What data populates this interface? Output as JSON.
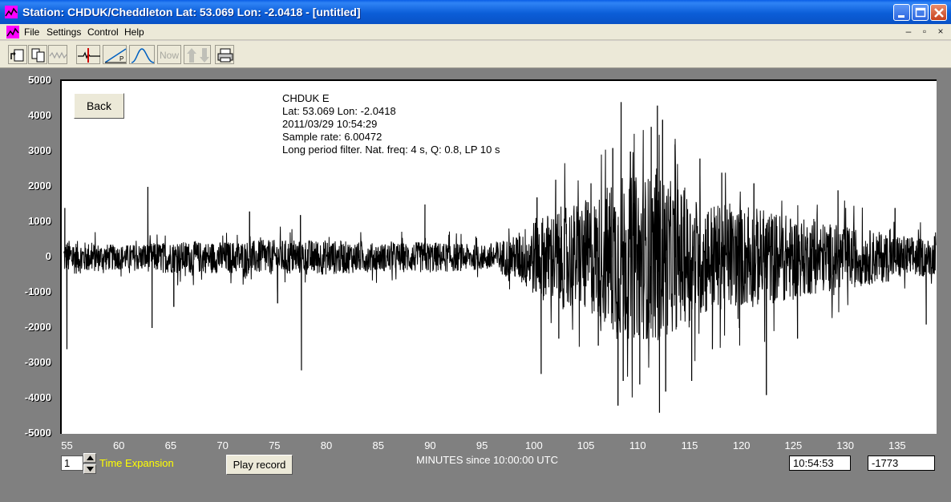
{
  "window": {
    "title": "Station: CHDUK/Cheddleton Lat: 53.069 Lon: -2.0418 - [untitled]"
  },
  "menu": [
    "File",
    "Settings",
    "Control",
    "Help"
  ],
  "toolbar": {
    "now_label": "Now"
  },
  "plot": {
    "back_label": "Back",
    "info": {
      "station": "CHDUK  E",
      "location": "Lat: 53.069 Lon: -2.0418",
      "datetime": "2011/03/29 10:54:29",
      "sample_rate": "Sample rate: 6.00472",
      "filter": "Long period filter. Nat. freq: 4 s, Q: 0.8, LP 10 s"
    }
  },
  "controls": {
    "time_expansion_value": "1",
    "time_expansion_label": "Time Expansion",
    "play_label": "Play record",
    "time_readout": "10:54:53",
    "value_readout": "-1773"
  },
  "chart_data": {
    "type": "line",
    "xlabel": "MINUTES since 10:00:00 UTC",
    "ylabel": "",
    "xlim": [
      54.5,
      138.8
    ],
    "ylim": [
      -5000,
      5000
    ],
    "xticks": [
      55,
      60,
      65,
      70,
      75,
      80,
      85,
      90,
      95,
      100,
      105,
      110,
      115,
      120,
      125,
      130,
      135
    ],
    "yticks": [
      5000,
      4000,
      3000,
      2000,
      1000,
      0,
      -1000,
      -2000,
      -3000,
      -4000,
      -5000
    ],
    "spikes": [
      {
        "x": 54.8,
        "v": 1400
      },
      {
        "x": 55.0,
        "v": -2600
      },
      {
        "x": 62.8,
        "v": 2000
      },
      {
        "x": 63.2,
        "v": -2000
      },
      {
        "x": 65.3,
        "v": -1400
      },
      {
        "x": 72.6,
        "v": 1300
      },
      {
        "x": 75.3,
        "v": -1300
      },
      {
        "x": 77.5,
        "v": 1200
      },
      {
        "x": 77.6,
        "v": -3200
      },
      {
        "x": 89.5,
        "v": 1500
      },
      {
        "x": 100.3,
        "v": 1700
      },
      {
        "x": 100.7,
        "v": -3300
      },
      {
        "x": 102.1,
        "v": 2200
      },
      {
        "x": 102.4,
        "v": -2300
      },
      {
        "x": 105.5,
        "v": 2100
      },
      {
        "x": 106.2,
        "v": -2500
      },
      {
        "x": 107.6,
        "v": 3100
      },
      {
        "x": 108.1,
        "v": -4200
      },
      {
        "x": 108.4,
        "v": 4400
      },
      {
        "x": 108.6,
        "v": -3500
      },
      {
        "x": 109.3,
        "v": 3000
      },
      {
        "x": 110.2,
        "v": -3600
      },
      {
        "x": 111.3,
        "v": 3700
      },
      {
        "x": 111.9,
        "v": 4300
      },
      {
        "x": 112.1,
        "v": -4400
      },
      {
        "x": 112.4,
        "v": 3900
      },
      {
        "x": 112.7,
        "v": -3800
      },
      {
        "x": 113.6,
        "v": 3200
      },
      {
        "x": 115.2,
        "v": -3500
      },
      {
        "x": 116.0,
        "v": 2800
      },
      {
        "x": 117.2,
        "v": -2600
      },
      {
        "x": 118.1,
        "v": 2400
      },
      {
        "x": 119.8,
        "v": -2000
      },
      {
        "x": 121.2,
        "v": 2100
      },
      {
        "x": 122.4,
        "v": -3900
      },
      {
        "x": 125.4,
        "v": -2300
      },
      {
        "x": 129.3,
        "v": 1900
      },
      {
        "x": 134.8,
        "v": 1400
      },
      {
        "x": 137.8,
        "v": -1900
      },
      {
        "x": 138.6,
        "v": 600
      }
    ],
    "envelope": [
      {
        "x": 55,
        "amp": 500
      },
      {
        "x": 60,
        "amp": 350
      },
      {
        "x": 65,
        "amp": 450
      },
      {
        "x": 70,
        "amp": 450
      },
      {
        "x": 75,
        "amp": 500
      },
      {
        "x": 80,
        "amp": 500
      },
      {
        "x": 85,
        "amp": 400
      },
      {
        "x": 90,
        "amp": 450
      },
      {
        "x": 95,
        "amp": 350
      },
      {
        "x": 98,
        "amp": 600
      },
      {
        "x": 100,
        "amp": 1100
      },
      {
        "x": 103,
        "amp": 1500
      },
      {
        "x": 106,
        "amp": 1700
      },
      {
        "x": 108,
        "amp": 2400
      },
      {
        "x": 110,
        "amp": 2300
      },
      {
        "x": 112,
        "amp": 2400
      },
      {
        "x": 115,
        "amp": 1800
      },
      {
        "x": 118,
        "amp": 1500
      },
      {
        "x": 122,
        "amp": 1400
      },
      {
        "x": 126,
        "amp": 1100
      },
      {
        "x": 130,
        "amp": 900
      },
      {
        "x": 134,
        "amp": 700
      },
      {
        "x": 138.7,
        "amp": 500
      }
    ]
  }
}
